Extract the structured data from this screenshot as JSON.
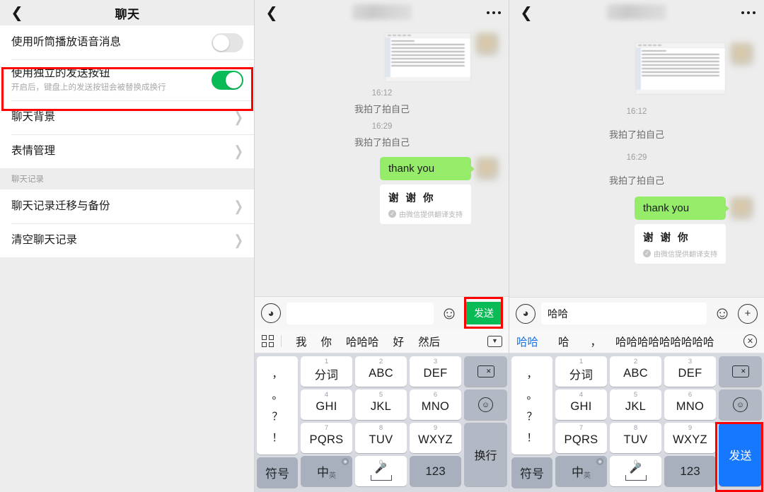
{
  "settings": {
    "nav": {
      "back_icon": "chevron-left-icon",
      "title": "聊天"
    },
    "rows": [
      {
        "label": "使用听筒播放语音消息",
        "sub": "",
        "control": "toggle",
        "on": false
      },
      {
        "label": "使用独立的发送按钮",
        "sub": "开启后，键盘上的发送按钮会被替换成换行",
        "control": "toggle",
        "on": true
      },
      {
        "label": "聊天背景",
        "sub": "",
        "control": "chevron"
      },
      {
        "label": "表情管理",
        "sub": "",
        "control": "chevron"
      }
    ],
    "section_header": "聊天记录",
    "rows2": [
      {
        "label": "聊天记录迁移与备份",
        "control": "chevron"
      },
      {
        "label": "清空聊天记录",
        "control": "chevron"
      }
    ],
    "highlight_color": "#ff0000",
    "toggle_on_color": "#09bb57"
  },
  "chat_left": {
    "nav": {
      "back_icon": "chevron-left-icon",
      "title_redacted": true,
      "more_icon": "more-dots-icon"
    },
    "messages": [
      {
        "type": "image",
        "kind": "document-screenshot"
      },
      {
        "type": "time",
        "text": "16:12"
      },
      {
        "type": "system",
        "text": "我拍了拍自己"
      },
      {
        "type": "time",
        "text": "16:29"
      },
      {
        "type": "system",
        "text": "我拍了拍自己"
      },
      {
        "type": "out",
        "text": "thank you",
        "translation": "谢 谢 你",
        "translation_note": "由微信提供翻译支持",
        "translation_badge": "✓"
      }
    ],
    "input": {
      "voice_icon": "voice-wave-icon",
      "value": "",
      "placeholder": "",
      "emoji_icon": "emoji-icon",
      "send_label": "发送",
      "send_style": "green",
      "send_highlighted": true
    },
    "candidates": {
      "grid_icon": "grid-icon",
      "items": [
        "我",
        "你",
        "哈哈哈",
        "好",
        "然后"
      ],
      "end_icon": "chevron-down-icon"
    },
    "keyboard": {
      "punct": [
        "，",
        "。",
        "？",
        "！"
      ],
      "keys": [
        {
          "num": "1",
          "label": "分词"
        },
        {
          "num": "2",
          "label": "ABC"
        },
        {
          "num": "3",
          "label": "DEF"
        },
        {
          "num": "4",
          "label": "GHI"
        },
        {
          "num": "5",
          "label": "JKL"
        },
        {
          "num": "6",
          "label": "MNO"
        },
        {
          "num": "7",
          "label": "PQRS"
        },
        {
          "num": "8",
          "label": "TUV"
        },
        {
          "num": "9",
          "label": "WXYZ"
        }
      ],
      "bottom": [
        {
          "label": "符号"
        },
        {
          "label": "中",
          "sub": "英",
          "globe": true
        },
        {
          "label": "0",
          "icon": "microphone-icon"
        },
        {
          "label": "123"
        }
      ],
      "side": [
        {
          "icon": "backspace-icon"
        },
        {
          "icon": "emoji-icon"
        },
        {
          "label": "换行",
          "style": "grey"
        }
      ]
    }
  },
  "chat_right": {
    "nav": {
      "back_icon": "chevron-left-icon",
      "title_redacted": true,
      "more_icon": "more-dots-icon"
    },
    "messages": [
      {
        "type": "image",
        "kind": "document-screenshot"
      },
      {
        "type": "time",
        "text": "16:12"
      },
      {
        "type": "system",
        "text": "我拍了拍自己"
      },
      {
        "type": "time",
        "text": "16:29"
      },
      {
        "type": "system",
        "text": "我拍了拍自己"
      },
      {
        "type": "out",
        "text": "thank you",
        "translation": "谢 谢 你",
        "translation_note": "由微信提供翻译支持",
        "translation_badge": "✓"
      }
    ],
    "input": {
      "voice_icon": "voice-wave-icon",
      "value": "哈哈",
      "placeholder": "",
      "emoji_icon": "emoji-icon",
      "plus_icon": "plus-icon"
    },
    "candidates": {
      "items": [
        "哈哈",
        "哈",
        "，",
        "哈哈哈哈哈哈哈哈哈"
      ],
      "end_icon": "close-circle-icon"
    },
    "keyboard": {
      "punct": [
        "，",
        "。",
        "？",
        "！"
      ],
      "keys": [
        {
          "num": "1",
          "label": "分词"
        },
        {
          "num": "2",
          "label": "ABC"
        },
        {
          "num": "3",
          "label": "DEF"
        },
        {
          "num": "4",
          "label": "GHI"
        },
        {
          "num": "5",
          "label": "JKL"
        },
        {
          "num": "6",
          "label": "MNO"
        },
        {
          "num": "7",
          "label": "PQRS"
        },
        {
          "num": "8",
          "label": "TUV"
        },
        {
          "num": "9",
          "label": "WXYZ"
        }
      ],
      "bottom": [
        {
          "label": "符号"
        },
        {
          "label": "中",
          "sub": "英",
          "globe": true
        },
        {
          "label": "0",
          "icon": "microphone-icon"
        },
        {
          "label": "123"
        }
      ],
      "side": [
        {
          "icon": "backspace-icon"
        },
        {
          "icon": "emoji-icon"
        },
        {
          "label": "发送",
          "style": "blue",
          "highlighted": true
        }
      ]
    }
  }
}
